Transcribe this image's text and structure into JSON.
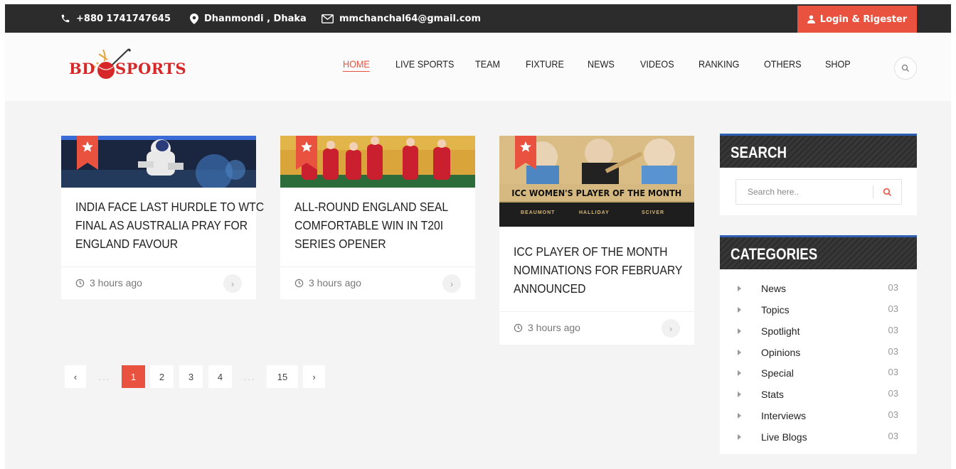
{
  "topbar": {
    "phone": "+880 1741747645",
    "location": "Dhanmondi , Dhaka",
    "email": "mmchanchal64@gmail.com",
    "login_label": "Login & Rigester",
    "icons": {
      "phone": "phone-icon",
      "location": "map-pin-icon",
      "email": "envelope-icon",
      "login": "user-icon"
    },
    "colors": {
      "background": "#2c2c2c",
      "login_bg": "#e9523f"
    }
  },
  "logo": {
    "text_left": "BD",
    "text_right": "SPORTS"
  },
  "nav": {
    "items": [
      "HOME",
      "LIVE SPORTS",
      "TEAM",
      "FIXTURE",
      "NEWS",
      "VIDEOS",
      "RANKING",
      "OTHERS",
      "SHOP"
    ],
    "active": "HOME",
    "accent": "#e9523f"
  },
  "cards": [
    {
      "title": "INDIA FACE LAST HURDLE TO WTC FINAL AS AUSTRALIA PRAY FOR ENGLAND FAVOUR",
      "time": "3 hours ago",
      "badge": "star-icon"
    },
    {
      "title": "ALL-ROUND ENGLAND SEAL COMFORTABLE WIN IN T20I SERIES OPENER",
      "time": "3 hours ago",
      "badge": "star-icon"
    },
    {
      "title": "ICC PLAYER OF THE MONTH NOMINATIONS FOR FEBRUARY ANNOUNCED",
      "time": "3 hours ago",
      "badge": "star-icon",
      "image_text": {
        "headline": "ICC WOMEN'S PLAYER OF THE MONTH",
        "names": [
          "BEAUMONT",
          "HALLIDAY",
          "SCIVER"
        ]
      }
    }
  ],
  "pagination": {
    "prev": "‹",
    "dots": "...",
    "pages": [
      "1",
      "2",
      "3",
      "4"
    ],
    "last": "15",
    "next": "›",
    "active": "1"
  },
  "sidebar": {
    "search": {
      "title": "SEARCH",
      "placeholder": "Search here.."
    },
    "categories": {
      "title": "CATEGORIES",
      "items": [
        {
          "name": "News",
          "count": "03"
        },
        {
          "name": "Topics",
          "count": "03"
        },
        {
          "name": "Spotlight",
          "count": "03"
        },
        {
          "name": "Opinions",
          "count": "03"
        },
        {
          "name": "Special",
          "count": "03"
        },
        {
          "name": "Stats",
          "count": "03"
        },
        {
          "name": "Interviews",
          "count": "03"
        },
        {
          "name": "Live Blogs",
          "count": "03"
        }
      ]
    }
  }
}
